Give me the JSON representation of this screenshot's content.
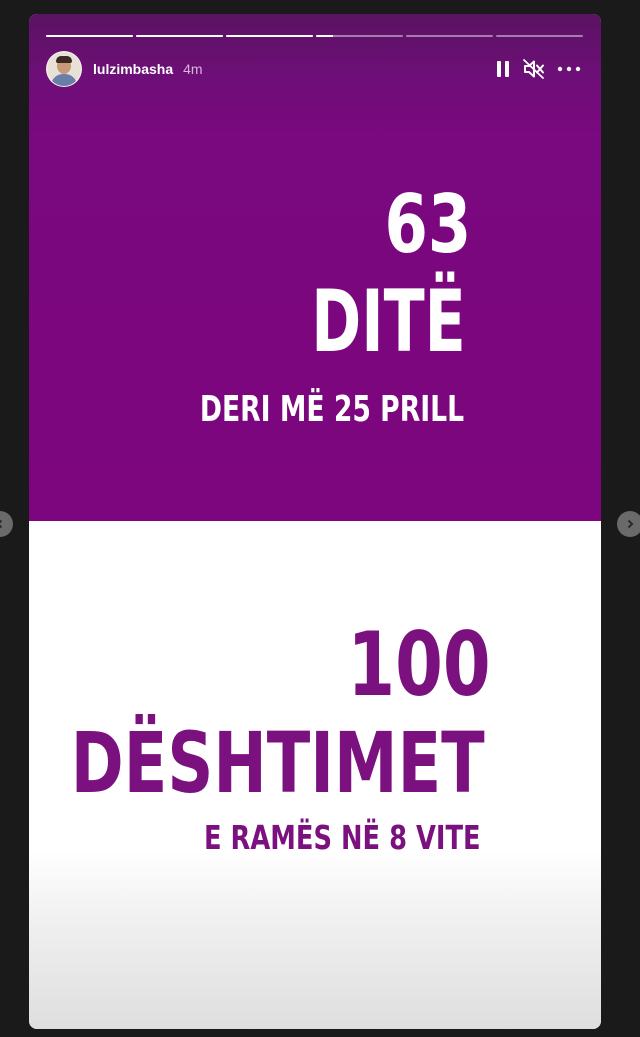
{
  "story": {
    "user": {
      "username": "lulzimbasha",
      "time_ago": "4m"
    },
    "progress": [
      1,
      1,
      1,
      0.2,
      0,
      0
    ],
    "icons": {
      "pause": "pause-icon",
      "mute": "speaker-muted-icon",
      "more": "more-horizontal-icon",
      "prev": "chevron-left-icon",
      "next": "chevron-right-icon"
    },
    "top_panel": {
      "number": "63",
      "word": "DITË",
      "subtitle": "DERI MË 25 PRILL",
      "background": "#7d057e",
      "text_color": "#ffffff"
    },
    "bottom_panel": {
      "number": "100",
      "word": "DËSHTIMET",
      "subtitle": "E RAMËS NË 8 VITE",
      "background": "#ffffff",
      "text_color": "#7a117f"
    }
  }
}
